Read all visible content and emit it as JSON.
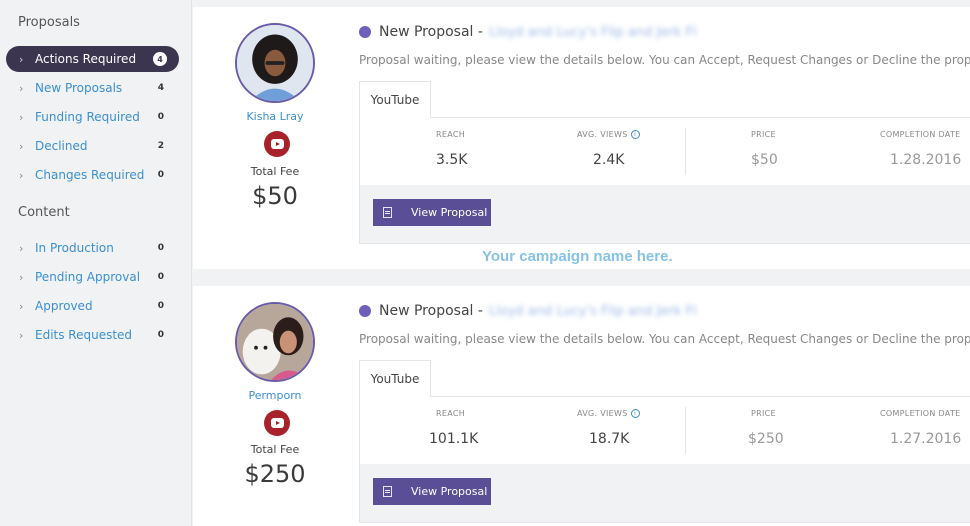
{
  "sidebar": {
    "proposals_title": "Proposals",
    "content_title": "Content",
    "proposals": [
      {
        "label": "Actions Required",
        "count": "4",
        "active": true
      },
      {
        "label": "New Proposals",
        "count": "4"
      },
      {
        "label": "Funding Required",
        "count": "0"
      },
      {
        "label": "Declined",
        "count": "2"
      },
      {
        "label": "Changes Required",
        "count": "0"
      }
    ],
    "content": [
      {
        "label": "In Production",
        "count": "0"
      },
      {
        "label": "Pending Approval",
        "count": "0"
      },
      {
        "label": "Approved",
        "count": "0"
      },
      {
        "label": "Edits Requested",
        "count": "0"
      }
    ],
    "chevron": "›"
  },
  "campaign_name": "Your campaign name here.",
  "proposals": [
    {
      "creator": "Kisha Lray",
      "fee_label": "Total Fee",
      "fee": "$50",
      "title": "New Proposal -",
      "title_blurred": "Lloyd and Lucy's Flip and Jerk Fl",
      "description": "Proposal waiting, please view the details below. You can Accept, Request Changes or Decline the proposal.",
      "tab": "YouTube",
      "stats": {
        "reach_label": "REACH",
        "reach": "3.5K",
        "views_label": "AVG. VIEWS",
        "views": "2.4K",
        "price_label": "PRICE",
        "price": "$50",
        "date_label": "COMPLETION DATE",
        "date": "1.28.2016"
      },
      "button": "View Proposal"
    },
    {
      "creator": "Permporn",
      "fee_label": "Total Fee",
      "fee": "$250",
      "title": "New Proposal -",
      "title_blurred": "Lloyd and Lucy's Flip and Jerk Fl",
      "description": "Proposal waiting, please view the details below. You can Accept, Request Changes or Decline the proposal.",
      "tab": "YouTube",
      "stats": {
        "reach_label": "REACH",
        "reach": "101.1K",
        "views_label": "AVG. VIEWS",
        "views": "18.7K",
        "price_label": "PRICE",
        "price": "$250",
        "date_label": "COMPLETION DATE",
        "date": "1.27.2016"
      },
      "button": "View Proposal"
    }
  ],
  "icons": {
    "info": "i",
    "youtube": "youtube-icon",
    "document": "document-icon"
  }
}
